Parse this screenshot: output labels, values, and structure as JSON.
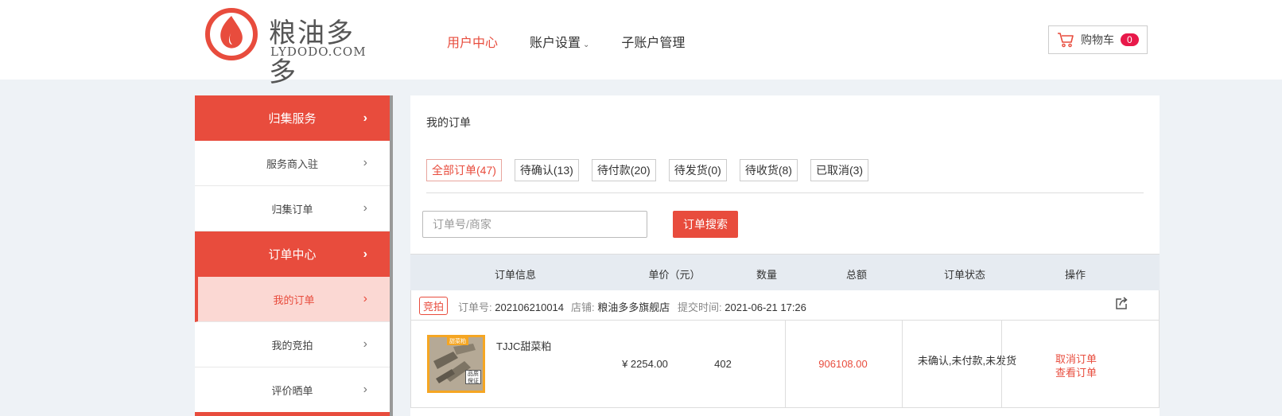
{
  "brand": {
    "name": "粮油多多",
    "domain": "LYDODO.COM",
    "color": "#e84c3d"
  },
  "nav": {
    "items": [
      {
        "label": "用户中心",
        "active": true
      },
      {
        "label": "账户设置",
        "has_dropdown": true
      },
      {
        "label": "子账户管理"
      }
    ]
  },
  "cart": {
    "label": "购物车",
    "count": "0",
    "icon": "cart-icon"
  },
  "sidebar": {
    "items": [
      {
        "label": "归集服务",
        "type": "group"
      },
      {
        "label": "服务商入驻"
      },
      {
        "label": "归集订单"
      },
      {
        "label": "订单中心",
        "type": "group"
      },
      {
        "label": "我的订单",
        "selected": true
      },
      {
        "label": "我的竞拍"
      },
      {
        "label": "评价晒单"
      }
    ]
  },
  "main": {
    "title": "我的订单",
    "tabs": [
      {
        "label": "全部订单(47)",
        "active": true
      },
      {
        "label": "待确认(13)"
      },
      {
        "label": "待付款(20)"
      },
      {
        "label": "待发货(0)"
      },
      {
        "label": "待收货(8)"
      },
      {
        "label": "已取消(3)"
      }
    ],
    "search": {
      "placeholder": "订单号/商家",
      "button": "订单搜索"
    },
    "table": {
      "headers": [
        "订单信息",
        "单价（元）",
        "数量",
        "总额",
        "订单状态",
        "操作"
      ]
    },
    "order": {
      "tag": "竞拍",
      "order_no_label": "订单号:",
      "order_no": "202106210014",
      "shop_label": "店铺:",
      "shop": "粮油多多旗舰店",
      "time_label": "提交时间:",
      "time": "2021-06-21 17:26",
      "product_name": "TJJC甜菜粕",
      "thumb_tag": "甜菜粕",
      "thumb_stamp": "品质保证",
      "unit_price": "¥ 2254.00",
      "quantity": "402",
      "total": "906108.00",
      "status": "未确认,未付款,未发货",
      "actions": [
        "取消订单",
        "查看订单"
      ]
    }
  }
}
